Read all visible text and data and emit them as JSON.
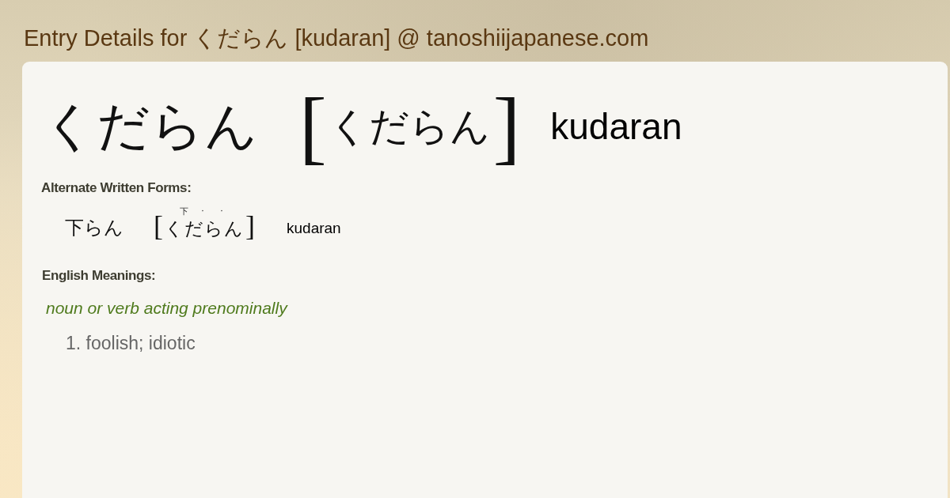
{
  "page_title": "Entry Details for くだらん [kudaran] @ tanoshiijapanese.com",
  "entry": {
    "word": "くだらん",
    "bracket_open": "[",
    "reading": "くだらん",
    "bracket_close": "]",
    "romaji": "kudaran"
  },
  "alternate_forms": {
    "heading": "Alternate Written Forms:",
    "items": [
      {
        "word": "下らん",
        "bracket_open": "[",
        "reading_marks": [
          "下",
          "·",
          "·"
        ],
        "reading": "くだらん",
        "bracket_close": "]",
        "romaji": "kudaran"
      }
    ]
  },
  "meanings": {
    "heading": "English Meanings:",
    "groups": [
      {
        "part_of_speech": "noun or verb acting prenominally",
        "senses": [
          "1. foolish; idiotic"
        ]
      }
    ]
  }
}
